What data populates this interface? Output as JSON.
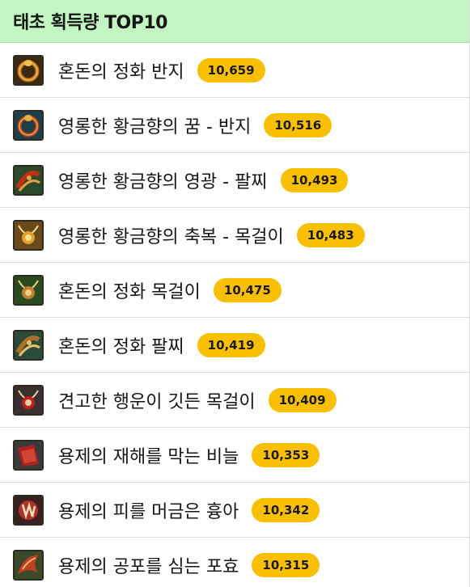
{
  "header": {
    "title": "태초 획득량 TOP10"
  },
  "colors": {
    "header_bg": "#c2f5c2",
    "badge_bg": "#f8c000",
    "divider": "#dedede"
  },
  "items": [
    {
      "name": "혼돈의 정화 반지",
      "count": "10,659",
      "icon": "ring-icon",
      "palette": [
        "#3a2a14",
        "#c8741e",
        "#f0c050"
      ]
    },
    {
      "name": "영롱한 황금향의 꿈 - 반지",
      "count": "10,516",
      "icon": "ring-icon",
      "palette": [
        "#1d3f4a",
        "#b8401e",
        "#e8b040"
      ]
    },
    {
      "name": "영롱한 황금향의 영광 - 팔찌",
      "count": "10,493",
      "icon": "bracelet-icon",
      "palette": [
        "#2a4a2a",
        "#c03018",
        "#e8a040"
      ]
    },
    {
      "name": "영롱한 황금향의 축복 - 목걸이",
      "count": "10,483",
      "icon": "necklace-icon",
      "palette": [
        "#6a4a1a",
        "#e0a030",
        "#f8e090"
      ]
    },
    {
      "name": "혼돈의 정화 목걸이",
      "count": "10,475",
      "icon": "necklace-icon",
      "palette": [
        "#2a4a20",
        "#c08030",
        "#f0d080"
      ]
    },
    {
      "name": "혼돈의 정화 팔찌",
      "count": "10,419",
      "icon": "bracelet-icon",
      "palette": [
        "#2a4a3a",
        "#a87028",
        "#e8c068"
      ]
    },
    {
      "name": "견고한 행운이 깃든 목걸이",
      "count": "10,409",
      "icon": "necklace-icon",
      "palette": [
        "#3a3030",
        "#c02020",
        "#e8d0a0"
      ]
    },
    {
      "name": "용제의 재해를 막는 비늘",
      "count": "10,353",
      "icon": "scale-icon",
      "palette": [
        "#3a3a3a",
        "#b02020",
        "#e86040"
      ]
    },
    {
      "name": "용제의 피를 머금은 흉아",
      "count": "10,342",
      "icon": "fang-icon",
      "palette": [
        "#3a2020",
        "#b03028",
        "#f0e0c0"
      ]
    },
    {
      "name": "용제의 공포를 심는 포효",
      "count": "10,315",
      "icon": "roar-icon",
      "palette": [
        "#3a4a2a",
        "#c04020",
        "#f0b070"
      ]
    }
  ]
}
